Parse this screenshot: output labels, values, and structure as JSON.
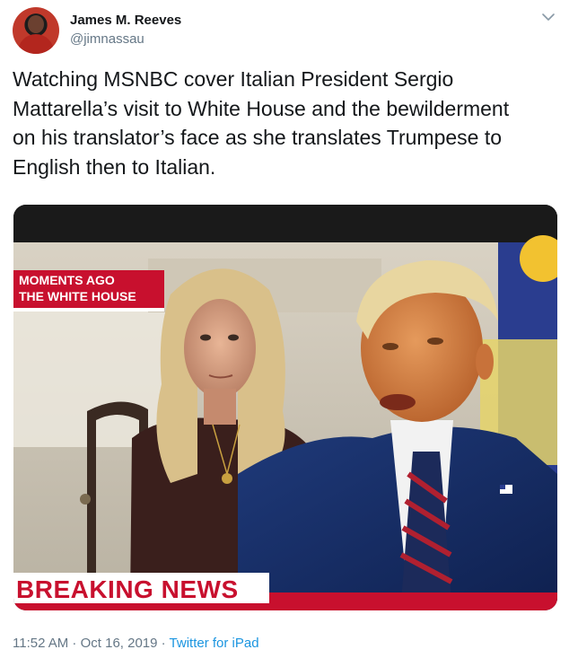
{
  "author": {
    "name": "James M. Reeves",
    "handle": "@jimnassau"
  },
  "tweet": {
    "text_lines": [
      "Watching MSNBC cover Italian President Sergio",
      "Mattarella’s visit to White House and the bewilderment",
      "on his translator’s face as she translates Trumpese to",
      "English then to Italian."
    ]
  },
  "media": {
    "chyron_line1": "MOMENTS AGO",
    "chyron_line2": "THE WHITE HOUSE",
    "breaking": "BREAKING NEWS"
  },
  "meta": {
    "timestamp": "11:52 AM · Oct 16, 2019 · ",
    "source": "Twitter for iPad"
  },
  "icons": {
    "caret": "chevron-down-icon"
  },
  "colors": {
    "link": "#1b95e0",
    "secondary": "#657786",
    "breaking_red": "#c8102e"
  }
}
